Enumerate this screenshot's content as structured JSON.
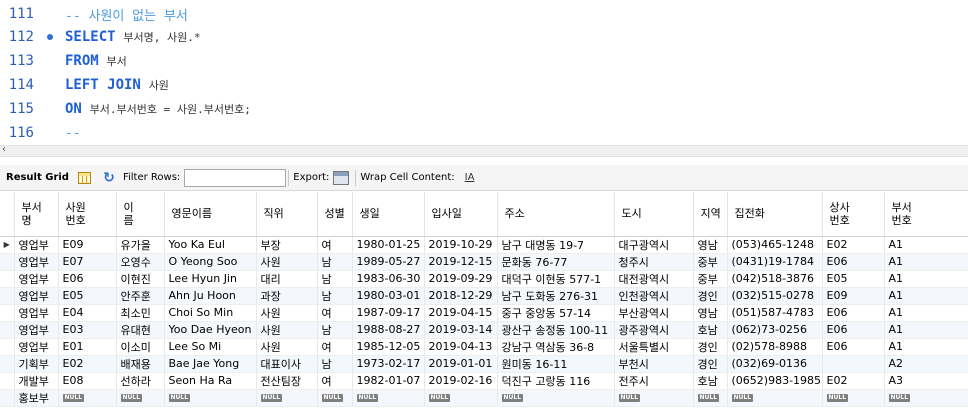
{
  "editor": {
    "lines": [
      {
        "num": "111",
        "comment": "-- 사원이 없는 부서"
      },
      {
        "num": "112",
        "kw": "SELECT",
        "rest": "부서명, 사원.*"
      },
      {
        "num": "113",
        "kw": "FROM",
        "rest": "부서"
      },
      {
        "num": "114",
        "kw": "LEFT JOIN",
        "rest": "사원"
      },
      {
        "num": "115",
        "kw": "ON",
        "rest": "부서.부서번호 = 사원.부서번호;"
      },
      {
        "num": "116",
        "comment": "--"
      }
    ]
  },
  "toolbar": {
    "result_grid": "Result Grid",
    "filter_rows": "Filter Rows:",
    "filter_value": "",
    "export": "Export:",
    "wrap_cell": "Wrap Cell Content:",
    "wrap_icon_glyph": "IA"
  },
  "grid": {
    "columns": [
      "부서명",
      "사원번호",
      "이름",
      "영문이름",
      "직위",
      "성별",
      "생일",
      "입사일",
      "주소",
      "도시",
      "지역",
      "집전화",
      "상사번호",
      "부서번호"
    ],
    "column_display": [
      "부서\n명",
      "사원\n번호",
      "이\n름",
      "영문이름",
      "직위",
      "성별",
      "생일",
      "입사일",
      "주소",
      "도시",
      "지역",
      "집전화",
      "상사\n번호",
      "부서\n번호"
    ],
    "null_label": "NULL",
    "rows": [
      [
        "영업부",
        "E09",
        "유가을",
        "Yoo Ka Eul",
        "부장",
        "여",
        "1980-01-25",
        "2019-10-29",
        "남구 대명동 19-7",
        "대구광역시",
        "영남",
        "(053)465-1248",
        "E02",
        "A1"
      ],
      [
        "영업부",
        "E07",
        "오영수",
        "O Yeong Soo",
        "사원",
        "남",
        "1989-05-27",
        "2019-12-15",
        "문화동 76-77",
        "청주시",
        "중부",
        "(0431)19-1784",
        "E06",
        "A1"
      ],
      [
        "영업부",
        "E06",
        "이현진",
        "Lee Hyun Jin",
        "대리",
        "남",
        "1983-06-30",
        "2019-09-29",
        "대덕구 이현동 577-1",
        "대전광역시",
        "중부",
        "(042)518-3876",
        "E05",
        "A1"
      ],
      [
        "영업부",
        "E05",
        "안주훈",
        "Ahn Ju Hoon",
        "과장",
        "남",
        "1980-03-01",
        "2018-12-29",
        "남구 도화동 276-31",
        "인천광역시",
        "경인",
        "(032)515-0278",
        "E09",
        "A1"
      ],
      [
        "영업부",
        "E04",
        "최소민",
        "Choi So Min",
        "사원",
        "여",
        "1987-09-17",
        "2019-04-15",
        "중구 중앙동 57-14",
        "부산광역시",
        "영남",
        "(051)587-4783",
        "E06",
        "A1"
      ],
      [
        "영업부",
        "E03",
        "유대현",
        "Yoo Dae Hyeon",
        "사원",
        "남",
        "1988-08-27",
        "2019-03-14",
        "광산구 송정동 100-11",
        "광주광역시",
        "호남",
        "(062)73-0256",
        "E06",
        "A1"
      ],
      [
        "영업부",
        "E01",
        "이소미",
        "Lee So Mi",
        "사원",
        "여",
        "1985-12-05",
        "2019-04-13",
        "강남구 역삼동 36-8",
        "서울특별시",
        "경인",
        "(02)578-8988",
        "E06",
        "A1"
      ],
      [
        "기획부",
        "E02",
        "배재용",
        "Bae Jae Yong",
        "대표이사",
        "남",
        "1973-02-17",
        "2019-01-01",
        "원미동 16-11",
        "부천시",
        "경인",
        "(032)69-0136",
        "",
        "A2"
      ],
      [
        "개발부",
        "E08",
        "선하라",
        "Seon Ha Ra",
        "전산팀장",
        "여",
        "1982-01-07",
        "2019-02-16",
        "덕진구 고랑동 116",
        "전주시",
        "호남",
        "(0652)983-1985",
        "E02",
        "A3"
      ],
      [
        "홍보부",
        null,
        null,
        null,
        null,
        null,
        null,
        null,
        null,
        null,
        null,
        null,
        null,
        null
      ]
    ]
  }
}
